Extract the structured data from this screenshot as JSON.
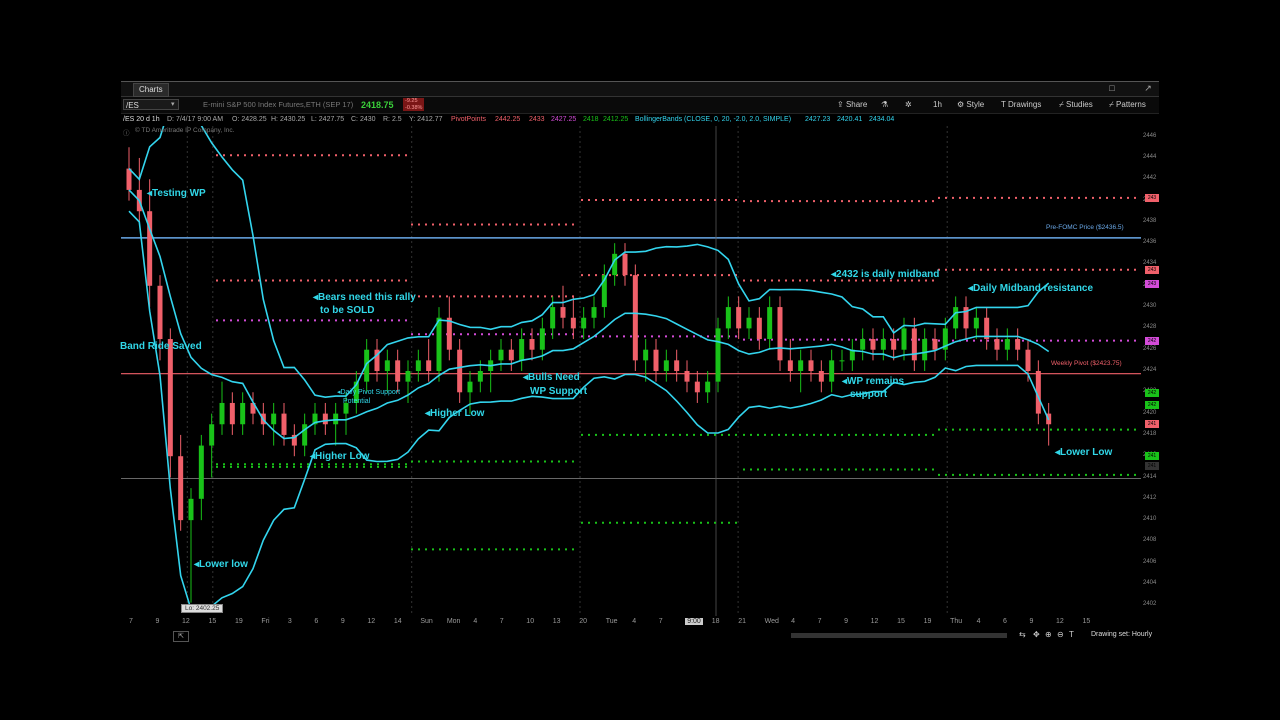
{
  "window": {
    "tab_label": "Charts",
    "buttons": [
      "□",
      "↗"
    ]
  },
  "toolbar": {
    "symbol": "/ES",
    "description": "E-mini S&P 500 Index Futures,ETH (SEP 17)",
    "last_price": "2418.75",
    "change": "-9.25",
    "change_pct": "-0.38%",
    "share_label": "Share",
    "timeframe": "1h",
    "style_label": "Style",
    "drawings_label": "Drawings",
    "studies_label": "Studies",
    "patterns_label": "Patterns"
  },
  "studybar": {
    "chart_id": "/ES 20 d 1h",
    "date": "D: 7/4/17 9:00 AM",
    "open": "O: 2428.25",
    "high": "H: 2430.25",
    "low": "L: 2427.75",
    "close": "C: 2430",
    "range": "R: 2.5",
    "y": "Y: 2412.77",
    "pivot_name": "PivotPoints",
    "pivot_values": [
      "2442.25",
      "2433",
      "2427.25",
      "2418",
      "2412.25"
    ],
    "bb_name": "BollingerBands (CLOSE, 0, 20, -2.0, 2.0, SIMPLE)",
    "bb_values": [
      "2427.23",
      "2420.41",
      "2434.04"
    ],
    "copyright": "© TD Ameritrade IP Company, Inc."
  },
  "colors": {
    "up": "#19c219",
    "down": "#f0606a",
    "bands": "#33d5ee",
    "pivot_r": "#f0606a",
    "pivot_s": "#19c219",
    "pivot_p": "#d34bd8",
    "prefomc": "#6aa8e8",
    "weekly": "#f0606a",
    "annotation": "#31d7e8"
  },
  "y_axis": {
    "labels": [
      "2446",
      "2444",
      "2442",
      "2440",
      "2438",
      "2436",
      "2434",
      "2432",
      "2430",
      "2428",
      "2426",
      "2424",
      "2422",
      "2420",
      "2418",
      "2416",
      "2414",
      "2412",
      "2410",
      "2408",
      "2406",
      "2404",
      "2402"
    ],
    "range": [
      2401,
      2447
    ],
    "tags": [
      {
        "text": "243",
        "value": 2440.2,
        "color": "#f0606a"
      },
      {
        "text": "243",
        "value": 2433.5,
        "color": "#f0606a"
      },
      {
        "text": "243",
        "value": 2432.2,
        "color": "#d34bd8"
      },
      {
        "text": "242",
        "value": 2426.8,
        "color": "#d34bd8"
      },
      {
        "text": "242",
        "value": 2421.9,
        "color": "#19c219"
      },
      {
        "text": "242",
        "value": 2420.8,
        "color": "#19c219"
      },
      {
        "text": "241",
        "value": 2419.0,
        "color": "#f0606a"
      },
      {
        "text": "241",
        "value": 2416.0,
        "color": "#19c219"
      },
      {
        "text": "241",
        "value": 2415.1,
        "color": "#333333"
      }
    ]
  },
  "x_axis": {
    "labels": [
      "7",
      "9",
      "12",
      "15",
      "19",
      "Fri",
      "3",
      "6",
      "9",
      "12",
      "14",
      "Sun",
      "Mon",
      "4",
      "7",
      "10",
      "13",
      "20",
      "Tue",
      "4",
      "7",
      "9:00",
      "18",
      "21",
      "Wed",
      "4",
      "7",
      "9",
      "12",
      "15",
      "19",
      "Thu",
      "4",
      "6",
      "9",
      "12",
      "15"
    ]
  },
  "annotations": [
    {
      "text": "◂Testing WP"
    },
    {
      "text": "◂Bears need this rally"
    },
    {
      "text": "to be SOLD"
    },
    {
      "text": "Band Ride Saved"
    },
    {
      "text": "◂Daily Pivot Support"
    },
    {
      "text": "Potential"
    },
    {
      "text": "◂Higher Low"
    },
    {
      "text": "◂Higher Low"
    },
    {
      "text": "◂Bulls Need"
    },
    {
      "text": "WP Support"
    },
    {
      "text": "◂2432 is daily midband"
    },
    {
      "text": "◂Daily Midband resistance"
    },
    {
      "text": "◂WP remains"
    },
    {
      "text": "support"
    },
    {
      "text": "◂Lower low"
    },
    {
      "text": "◂Lower Low"
    }
  ],
  "lines": {
    "prefomc_label": "Pre-FOMC Price ($2436.5)",
    "weekly_label": "Weekly Pivot ($2423.75)",
    "low_label": "Lo: 2402.25"
  },
  "footer": {
    "drawing_set": "Drawing set: Hourly"
  },
  "chart_data": {
    "type": "candlestick",
    "symbol": "/ES",
    "timeframe": "1h",
    "ylim": [
      2401,
      2447
    ],
    "prefomc_price": 2436.5,
    "weekly_pivot": 2423.75,
    "low_marker": 2402.25,
    "candles": [
      [
        2443,
        2445,
        2440,
        2441
      ],
      [
        2441,
        2444,
        2438,
        2439
      ],
      [
        2439,
        2442,
        2430,
        2432
      ],
      [
        2432,
        2433,
        2425,
        2427
      ],
      [
        2427,
        2428,
        2414,
        2416
      ],
      [
        2416,
        2418,
        2409,
        2410
      ],
      [
        2410,
        2413,
        2402.25,
        2412
      ],
      [
        2412,
        2418,
        2410,
        2417
      ],
      [
        2417,
        2420,
        2414,
        2419
      ],
      [
        2419,
        2423,
        2418,
        2421
      ],
      [
        2421,
        2422,
        2418,
        2419
      ],
      [
        2419,
        2422,
        2418,
        2421
      ],
      [
        2421,
        2422,
        2419,
        2420
      ],
      [
        2420,
        2421,
        2418,
        2419
      ],
      [
        2419,
        2421,
        2417,
        2420
      ],
      [
        2420,
        2421,
        2417,
        2418
      ],
      [
        2418,
        2419,
        2416,
        2417
      ],
      [
        2417,
        2420,
        2416,
        2419
      ],
      [
        2419,
        2421,
        2418,
        2420
      ],
      [
        2420,
        2421,
        2418,
        2419
      ],
      [
        2419,
        2421,
        2417,
        2420
      ],
      [
        2420,
        2422,
        2418,
        2421
      ],
      [
        2421,
        2424,
        2420,
        2423
      ],
      [
        2423,
        2427,
        2422,
        2426
      ],
      [
        2426,
        2427,
        2423,
        2424
      ],
      [
        2424,
        2426,
        2422,
        2425
      ],
      [
        2425,
        2426,
        2422,
        2423
      ],
      [
        2423,
        2425,
        2421,
        2424
      ],
      [
        2424,
        2426,
        2423,
        2425
      ],
      [
        2425,
        2427,
        2423,
        2424
      ],
      [
        2424,
        2430,
        2423,
        2429
      ],
      [
        2429,
        2431,
        2425,
        2426
      ],
      [
        2426,
        2427,
        2421,
        2422
      ],
      [
        2422,
        2424,
        2420,
        2423
      ],
      [
        2423,
        2425,
        2422,
        2424
      ],
      [
        2424,
        2426,
        2422,
        2425
      ],
      [
        2425,
        2427,
        2424,
        2426
      ],
      [
        2426,
        2427,
        2424,
        2425
      ],
      [
        2425,
        2428,
        2424,
        2427
      ],
      [
        2427,
        2428,
        2425,
        2426
      ],
      [
        2426,
        2429,
        2425,
        2428
      ],
      [
        2428,
        2431,
        2427,
        2430
      ],
      [
        2430,
        2432,
        2428,
        2429
      ],
      [
        2429,
        2431,
        2427,
        2428
      ],
      [
        2428,
        2430,
        2427,
        2429
      ],
      [
        2429,
        2431,
        2428,
        2430
      ],
      [
        2430,
        2434,
        2429,
        2433
      ],
      [
        2433,
        2436,
        2432,
        2435
      ],
      [
        2435,
        2436,
        2432,
        2433
      ],
      [
        2433,
        2434,
        2424,
        2425
      ],
      [
        2425,
        2427,
        2423,
        2426
      ],
      [
        2426,
        2427,
        2423,
        2424
      ],
      [
        2424,
        2426,
        2423,
        2425
      ],
      [
        2425,
        2426,
        2423,
        2424
      ],
      [
        2424,
        2425,
        2422,
        2423
      ],
      [
        2423,
        2424,
        2421,
        2422
      ],
      [
        2422,
        2424,
        2421,
        2423
      ],
      [
        2423,
        2429,
        2422,
        2428
      ],
      [
        2428,
        2431,
        2427,
        2430
      ],
      [
        2430,
        2431,
        2427,
        2428
      ],
      [
        2428,
        2430,
        2427,
        2429
      ],
      [
        2429,
        2430,
        2426,
        2427
      ],
      [
        2427,
        2431,
        2426,
        2430
      ],
      [
        2430,
        2431,
        2424,
        2425
      ],
      [
        2425,
        2427,
        2423,
        2424
      ],
      [
        2424,
        2426,
        2422,
        2425
      ],
      [
        2425,
        2426,
        2423,
        2424
      ],
      [
        2424,
        2425,
        2422,
        2423
      ],
      [
        2423,
        2426,
        2422,
        2425
      ],
      [
        2425,
        2426,
        2424,
        2425
      ],
      [
        2425,
        2427,
        2424,
        2426
      ],
      [
        2426,
        2428,
        2425,
        2427
      ],
      [
        2427,
        2428,
        2425,
        2426
      ],
      [
        2426,
        2428,
        2425,
        2427
      ],
      [
        2427,
        2428,
        2425,
        2426
      ],
      [
        2426,
        2429,
        2425,
        2428
      ],
      [
        2428,
        2429,
        2424,
        2425
      ],
      [
        2425,
        2428,
        2424,
        2427
      ],
      [
        2427,
        2428,
        2425,
        2426
      ],
      [
        2426,
        2429,
        2425,
        2428
      ],
      [
        2428,
        2431,
        2427,
        2430
      ],
      [
        2430,
        2431,
        2427,
        2428
      ],
      [
        2428,
        2430,
        2427,
        2429
      ],
      [
        2429,
        2430,
        2426,
        2427
      ],
      [
        2427,
        2428,
        2425,
        2426
      ],
      [
        2426,
        2428,
        2425,
        2427
      ],
      [
        2427,
        2428,
        2425,
        2426
      ],
      [
        2426,
        2427,
        2423,
        2424
      ],
      [
        2424,
        2425,
        2419,
        2420
      ],
      [
        2420,
        2421,
        2417,
        2419
      ]
    ],
    "pivot_levels": {
      "R": 2442.25,
      "R1": 2433,
      "P": 2427.25,
      "S1": 2418,
      "S2": 2412.25
    }
  }
}
